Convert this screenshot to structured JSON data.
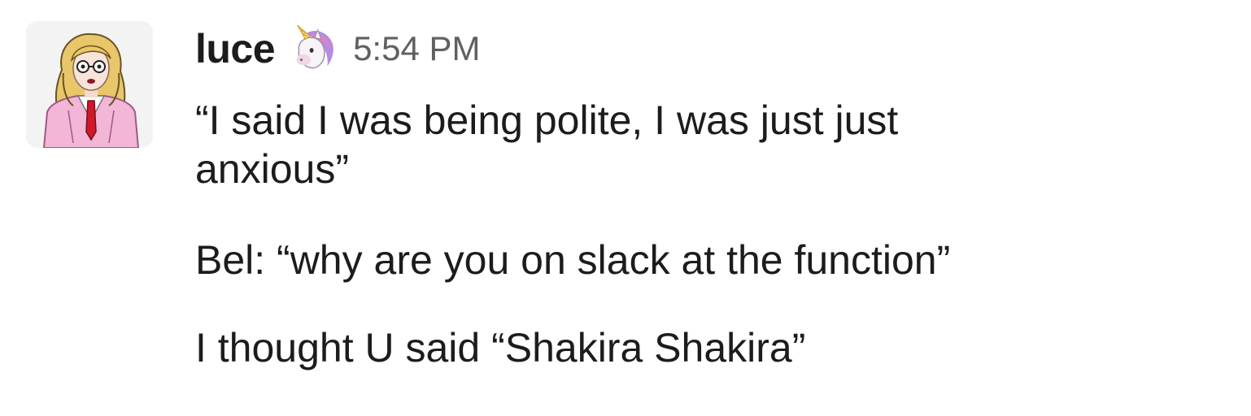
{
  "message": {
    "sender": "luce",
    "status_emoji": "unicorn-icon",
    "timestamp": "5:54 PM",
    "avatar": "cartoon-avatar-blonde-glasses-pink-blazer",
    "lines": [
      {
        "text_line1": "“I said I was being polite, I was just just",
        "text_line2": "anxious”"
      },
      {
        "text": "Bel: “why are you on slack at the function”"
      },
      {
        "text": "I thought U said “Shakira Shakira”"
      }
    ]
  },
  "colors": {
    "text": "#1d1c1d",
    "timestamp": "#616061",
    "avatar_bg": "#f3f3f3",
    "blazer_pink": "#f2b6d6",
    "tie_red": "#d1182b",
    "hair_blonde": "#e8c66a"
  }
}
